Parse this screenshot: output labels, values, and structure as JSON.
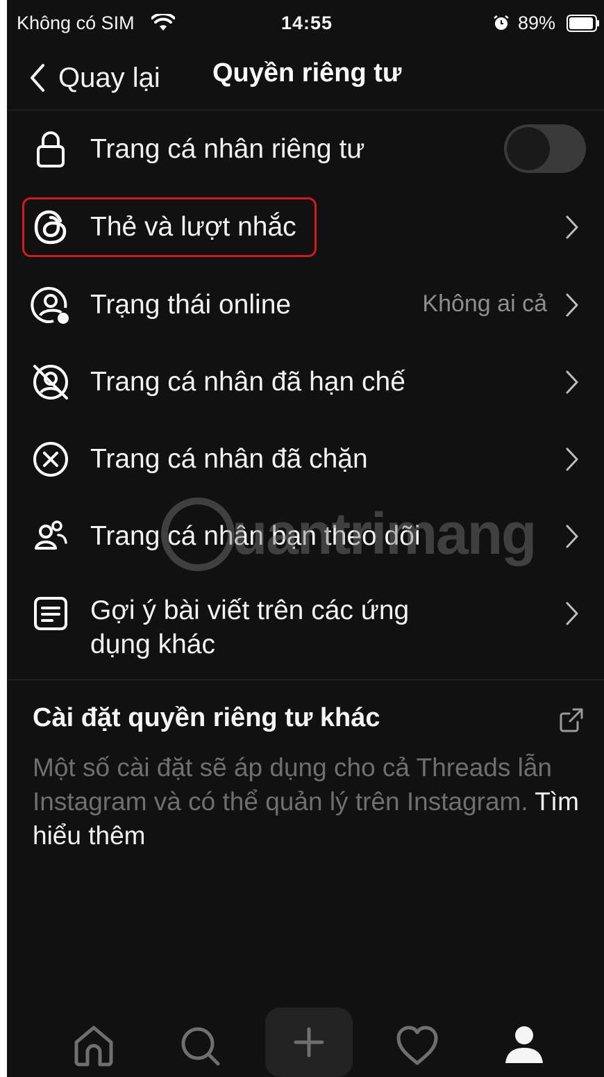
{
  "status_bar": {
    "carrier": "Không có SIM",
    "time": "14:55",
    "battery": "89%"
  },
  "nav": {
    "back_label": "Quay lại",
    "title": "Quyền riêng tư"
  },
  "rows": [
    {
      "label": "Trang cá nhân riêng tư",
      "icon": "lock-icon",
      "toggle_on": false
    },
    {
      "label": "Thẻ và lượt nhắc",
      "icon": "threads-icon",
      "highlighted": true
    },
    {
      "label": "Trạng thái online",
      "icon": "online-status-icon",
      "value": "Không ai cả"
    },
    {
      "label": "Trang cá nhân đã hạn chế",
      "icon": "restricted-icon"
    },
    {
      "label": "Trang cá nhân đã chặn",
      "icon": "blocked-icon"
    },
    {
      "label": "Trang cá nhân bạn theo dõi",
      "icon": "people-icon"
    },
    {
      "label": "Gợi ý bài viết trên các ứng",
      "label_line2": "dụng khác",
      "icon": "document-icon"
    }
  ],
  "section": {
    "title": "Cài đặt quyền riêng tư khác",
    "description": "Một số cài đặt sẽ áp dụng cho cả Threads lẫn Instagram và có thể quản lý trên Instagram.",
    "link": "Tìm hiểu thêm"
  },
  "watermark": "uantrimang",
  "tabbar": [
    "home-icon",
    "search-icon",
    "create-icon",
    "heart-icon",
    "profile-icon"
  ],
  "colors": {
    "background": "#111111",
    "text": "#f3f3f3",
    "secondary": "#8e8e8e",
    "highlight_border": "#d5191f",
    "toggle_off": "#3a3a3a"
  }
}
